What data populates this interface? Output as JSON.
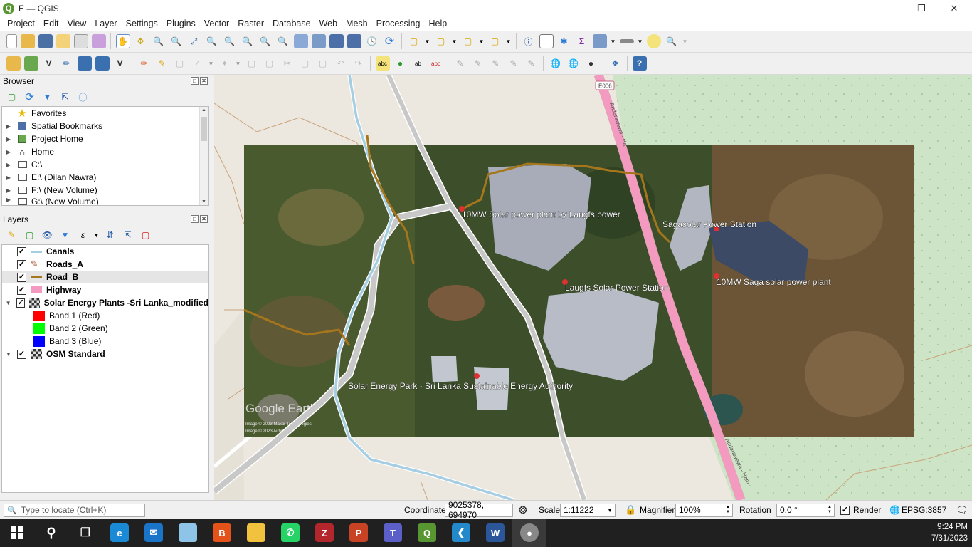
{
  "window": {
    "title": "E — QGIS",
    "logo": "Q"
  },
  "menu": [
    "Project",
    "Edit",
    "View",
    "Layer",
    "Settings",
    "Plugins",
    "Vector",
    "Raster",
    "Database",
    "Web",
    "Mesh",
    "Processing",
    "Help"
  ],
  "browser": {
    "title": "Browser",
    "items": [
      {
        "label": "Favorites",
        "icon": "star-icon"
      },
      {
        "label": "Spatial Bookmarks",
        "icon": "bookmark-icon"
      },
      {
        "label": "Project Home",
        "icon": "project-home-icon"
      },
      {
        "label": "Home",
        "icon": "home-icon"
      },
      {
        "label": "C:\\",
        "icon": "folder-icon"
      },
      {
        "label": "E:\\ (Dilan Nawra)",
        "icon": "folder-icon"
      },
      {
        "label": "F:\\ (New Volume)",
        "icon": "folder-icon"
      },
      {
        "label": "G:\\ (New Volume)",
        "icon": "folder-icon"
      }
    ]
  },
  "layers": {
    "title": "Layers",
    "items": [
      {
        "label": "Canals",
        "checked": true,
        "bold": true,
        "symbol": "line",
        "color": "#a6cee3"
      },
      {
        "label": "Roads_A",
        "checked": true,
        "bold": true,
        "symbol": "edit-line",
        "color": "#b06040"
      },
      {
        "label": "Road_B",
        "checked": true,
        "bold": true,
        "symbol": "line",
        "color": "#a6761d",
        "selected": true
      },
      {
        "label": "Highway",
        "checked": true,
        "bold": true,
        "symbol": "fill",
        "color": "#f49ac0"
      },
      {
        "label": "Solar Energy Plants -Sri Lanka_modified",
        "checked": true,
        "bold": true,
        "symbol": "raster",
        "expanded": true
      },
      {
        "label": "Band 1 (Red)",
        "band": true,
        "color": "#ff0000"
      },
      {
        "label": "Band 2 (Green)",
        "band": true,
        "color": "#00ff00"
      },
      {
        "label": "Band 3 (Blue)",
        "band": true,
        "color": "#0000ff"
      },
      {
        "label": "OSM Standard",
        "checked": true,
        "bold": true,
        "symbol": "raster",
        "expanded": true
      }
    ]
  },
  "map": {
    "labels": {
      "plant1": "10MW Solar power plant by Laugfs power",
      "plant2": "Sagasolar Power Station",
      "plant3": "Laugfs Solar Power Station",
      "plant4": "10MW Saga solar power plant",
      "plant5": "Solar Energy Park - Sri Lanka Sustainable Energy Authority",
      "road_ref": "E006",
      "road_name": "Andarawewa - Ha",
      "road_name2": "Andarawewa - Ham",
      "watermark": "Google Earth",
      "credits1": "Image © 2023 Maxar Technologies",
      "credits2": "Image © 2023 Airbus"
    }
  },
  "status": {
    "search_placeholder": "Type to locate (Ctrl+K)",
    "coordinate_label": "Coordinate",
    "coordinate": "9025378, 694970",
    "scale_label": "Scale",
    "scale": "1:11222",
    "magnifier_label": "Magnifier",
    "magnifier": "100%",
    "rotation_label": "Rotation",
    "rotation": "0.0 °",
    "render_label": "Render",
    "render_checked": true,
    "crs": "EPSG:3857"
  },
  "taskbar": {
    "apps": [
      "windows-start-icon",
      "search-icon",
      "task-view-icon",
      "edge-icon",
      "mail-icon",
      "notes-icon",
      "brave-icon",
      "file-explorer-icon",
      "whatsapp-icon",
      "winrar-icon",
      "powerpoint-icon",
      "teams-icon",
      "qgis-icon",
      "vscode-icon",
      "word-icon",
      "app-icon"
    ],
    "time": "9:24 PM",
    "date": "7/31/2023"
  }
}
